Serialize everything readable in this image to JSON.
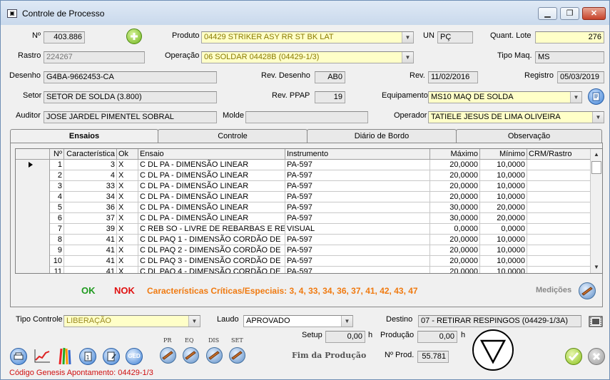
{
  "window": {
    "title": "Controle de Processo"
  },
  "header": {
    "numero_label": "Nº",
    "numero": "403.886",
    "produto_label": "Produto",
    "produto": "04429  STRIKER ASY RR ST BK LAT",
    "un_label": "UN",
    "un": "PÇ",
    "quant_lote_label": "Quant. Lote",
    "quant_lote": "276",
    "rastro_label": "Rastro",
    "rastro": "224267",
    "operacao_label": "Operação",
    "operacao": "06  SOLDAR 04428B (04429-1/3)",
    "tipo_maq_label": "Tipo Maq.",
    "tipo_maq": "MS",
    "desenho_label": "Desenho",
    "desenho": "G4BA-9662453-CA",
    "rev_desenho_label": "Rev. Desenho",
    "rev_desenho": "AB0",
    "rev_label": "Rev.",
    "rev": "11/02/2016",
    "registro_label": "Registro",
    "registro": "05/03/2019",
    "setor_label": "Setor",
    "setor": "SETOR DE SOLDA (3.800)",
    "rev_ppap_label": "Rev. PPAP",
    "rev_ppap": "19",
    "equipamento_label": "Equipamento",
    "equipamento": "MS10  MAQ DE SOLDA",
    "auditor_label": "Auditor",
    "auditor": "JOSE JARDEL PIMENTEL SOBRAL",
    "molde_label": "Molde",
    "molde": "",
    "operador_label": "Operador",
    "operador": "TATIELE JESUS DE LIMA OLIVEIRA"
  },
  "tabs": [
    "Ensaios",
    "Controle",
    "Diário de Bordo",
    "Observação"
  ],
  "grid": {
    "columns": [
      "Nº",
      "Característica",
      "Ok",
      "Ensaio",
      "Instrumento",
      "Máximo",
      "Mínimo",
      "CRM/Rastro"
    ],
    "rows": [
      [
        "1",
        "3",
        "X",
        "C DL PA  -  DIMENSÃO LINEAR",
        "PA-597",
        "20,0000",
        "10,0000",
        ""
      ],
      [
        "2",
        "4",
        "X",
        "C DL PA  -  DIMENSÃO LINEAR",
        "PA-597",
        "20,0000",
        "10,0000",
        ""
      ],
      [
        "3",
        "33",
        "X",
        "C DL PA  -  DIMENSÃO LINEAR",
        "PA-597",
        "20,0000",
        "10,0000",
        ""
      ],
      [
        "4",
        "34",
        "X",
        "C DL PA  -  DIMENSÃO LINEAR",
        "PA-597",
        "20,0000",
        "10,0000",
        ""
      ],
      [
        "5",
        "36",
        "X",
        "C DL PA  -  DIMENSÃO LINEAR",
        "PA-597",
        "30,0000",
        "20,0000",
        ""
      ],
      [
        "6",
        "37",
        "X",
        "C DL PA  -  DIMENSÃO LINEAR",
        "PA-597",
        "30,0000",
        "20,0000",
        ""
      ],
      [
        "7",
        "39",
        "X",
        "C REB SO  -  LIVRE DE REBARBAS E RE",
        "VISUAL",
        "0,0000",
        "0,0000",
        ""
      ],
      [
        "8",
        "41",
        "X",
        "C DL PAQ 1  -  DIMENSÃO CORDÃO DE",
        "PA-597",
        "20,0000",
        "10,0000",
        ""
      ],
      [
        "9",
        "41",
        "X",
        "C DL PAQ 2  -  DIMENSÃO CORDÃO DE",
        "PA-597",
        "20,0000",
        "10,0000",
        ""
      ],
      [
        "10",
        "41",
        "X",
        "C DL PAQ 3  -  DIMENSÃO CORDÃO DE",
        "PA-597",
        "20,0000",
        "10,0000",
        ""
      ],
      [
        "11",
        "41",
        "X",
        "C DL PAQ 4  -  DIMENSÃO CORDÃO DE",
        "PA-597",
        "20,0000",
        "10,0000",
        ""
      ]
    ]
  },
  "status": {
    "ok": "OK",
    "nok": "NOK",
    "criticas": "Características Críticas/Especiais: 3, 4, 33, 34, 36, 37, 41, 42, 43, 47",
    "medicoes": "Medições"
  },
  "bottom": {
    "tipo_controle_label": "Tipo Controle",
    "tipo_controle": "LIBERAÇÃO",
    "laudo_label": "Laudo",
    "laudo": "APROVADO",
    "destino_label": "Destino",
    "destino": "07 - RETIRAR RESPINGOS (04429-1/3A)",
    "setup_label": "Setup",
    "setup": "0,00",
    "setup_unit": "h",
    "producao_label": "Produção",
    "producao": "0,00",
    "producao_unit": "h",
    "fim_label": "Fim da Produção",
    "nprod_label": "Nº Prod.",
    "nprod": "55.781",
    "tool_labels": [
      "PR",
      "EQ",
      "DIS",
      "SET"
    ],
    "ged": "GED",
    "codigo": "Código Genesis Apontamento: 04429-1/3"
  },
  "icons": [
    "add-icon",
    "info-icon",
    "document-icon",
    "chart-icon",
    "pencils-icon",
    "print-icon",
    "ok-icon",
    "cancel-icon",
    "film-icon",
    "triangle-down-icon"
  ],
  "colors": {
    "ok": "#1e9a1e",
    "nok": "#e01010",
    "critical": "#f07a10",
    "footer": "#d01010",
    "yellow_field": "#ffffc8"
  }
}
